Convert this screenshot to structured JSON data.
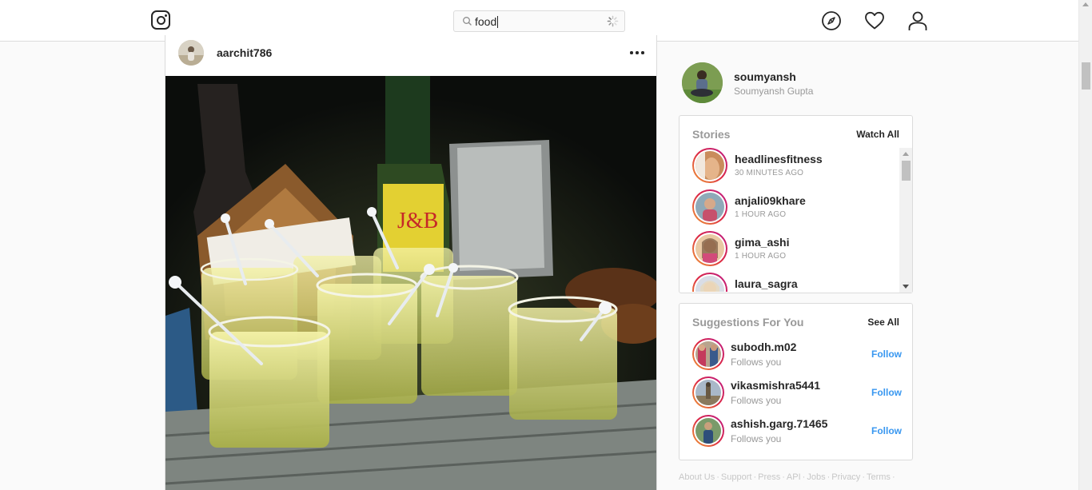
{
  "search": {
    "value": "food",
    "placeholder": "Search"
  },
  "nav": {
    "icons": [
      "instagram-logo-icon",
      "explore-compass-icon",
      "activity-heart-icon",
      "profile-user-icon"
    ]
  },
  "post": {
    "username": "aarchit786"
  },
  "profile": {
    "username": "soumyansh",
    "full_name": "Soumyansh Gupta"
  },
  "stories": {
    "title": "Stories",
    "watch_all": "Watch All",
    "items": [
      {
        "username": "headlinesfitness",
        "time": "30 MINUTES AGO"
      },
      {
        "username": "anjali09khare",
        "time": "1 HOUR AGO"
      },
      {
        "username": "gima_ashi",
        "time": "1 HOUR AGO"
      },
      {
        "username": "laura_sagra",
        "time": ""
      }
    ]
  },
  "suggestions": {
    "title": "Suggestions For You",
    "see_all": "See All",
    "items": [
      {
        "username": "subodh.m02",
        "subtitle": "Follows you",
        "action": "Follow"
      },
      {
        "username": "vikasmishra5441",
        "subtitle": "Follows you",
        "action": "Follow"
      },
      {
        "username": "ashish.garg.71465",
        "subtitle": "Follows you",
        "action": "Follow"
      }
    ]
  },
  "footer": {
    "links": [
      "About Us",
      "Support",
      "Press",
      "API",
      "Jobs",
      "Privacy",
      "Terms"
    ]
  },
  "colors": {
    "link_blue": "#3897f0",
    "border": "#dbdbdb",
    "muted": "#999999"
  }
}
